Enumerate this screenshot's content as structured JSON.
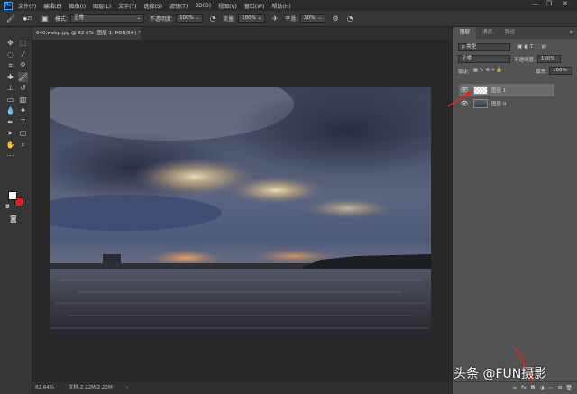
{
  "menubar": {
    "logo": "Ps",
    "items": [
      "文件(F)",
      "编辑(E)",
      "图像(I)",
      "图层(L)",
      "文字(Y)",
      "选择(S)",
      "滤镜(T)",
      "3D(D)",
      "视图(V)",
      "窗口(W)",
      "帮助(H)"
    ],
    "minimize": "—",
    "maximize": "❐",
    "close": "✕"
  },
  "options": {
    "mode_label": "模式:",
    "mode_value": "正常",
    "opacity_label": "不透明度:",
    "opacity_value": "100%",
    "flow_label": "流量:",
    "flow_value": "100%",
    "smooth_label": "平滑:",
    "smooth_value": "10%",
    "brush_size": "25"
  },
  "document": {
    "tab_title": "640.webp.jpg @ 82.6% (图层 1, RGB/8#) *",
    "tab_close": "×"
  },
  "status": {
    "zoom": "82.64%",
    "doc_info": "文档:2.22M/2.22M",
    "arrow": "›"
  },
  "layers_panel": {
    "tabs": [
      "图层",
      "通道",
      "路径"
    ],
    "kind_label": "ρ 类型",
    "blend_mode": "正常",
    "opacity_label": "不透明度:",
    "opacity_value": "100%",
    "lock_label": "锁定:",
    "fill_label": "填充:",
    "fill_value": "100%",
    "layers": [
      {
        "name": "图层 1"
      },
      {
        "name": "图层 0"
      }
    ]
  },
  "watermark": "头条 @FUN摄影",
  "colors": {
    "foreground": "#ffffff",
    "background": "#e21b1b",
    "annotation_arrow": "#e8231f"
  }
}
